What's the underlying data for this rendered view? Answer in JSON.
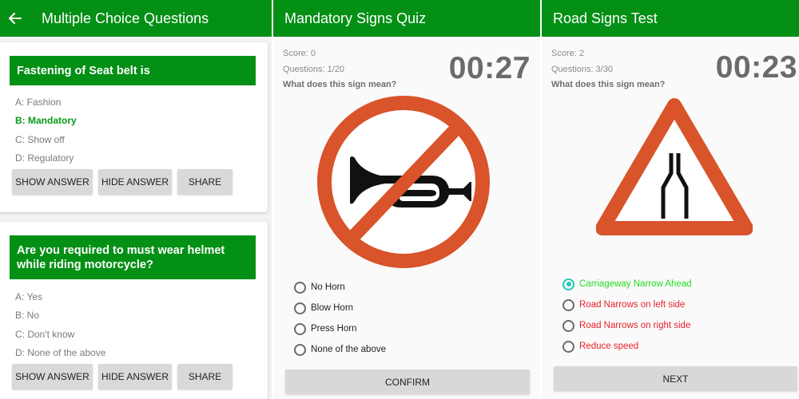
{
  "mcq": {
    "title": "Multiple Choice Questions",
    "back_icon": "arrow-left",
    "questions": [
      {
        "question": "Fastening of Seat belt is",
        "options": [
          "A: Fashion",
          "B: Mandatory",
          "C: Show off",
          "D: Regulatory"
        ],
        "highlighted_option": 1,
        "buttons": [
          "SHOW ANSWER",
          "HIDE ANSWER",
          "SHARE"
        ]
      },
      {
        "question": "Are you required to must wear helmet while riding motorcycle?",
        "options": [
          "A: Yes",
          "B: No",
          "C: Don't know",
          "D: None of the above"
        ],
        "highlighted_option": null,
        "buttons": [
          "SHOW ANSWER",
          "HIDE ANSWER",
          "SHARE"
        ]
      }
    ]
  },
  "mandatory_quiz": {
    "title": "Mandatory Signs Quiz",
    "score": "Score: 0",
    "questions": "Questions: 1/20",
    "prompt": "What does this sign mean?",
    "timer": "00:27",
    "sign": "no-horn-sign",
    "options": [
      "No Horn",
      "Blow Horn",
      "Press Horn",
      "None of the above"
    ],
    "selected": null,
    "button": "CONFIRM"
  },
  "road_test": {
    "title": "Road Signs Test",
    "score": "Score: 2",
    "questions": "Questions: 3/30",
    "prompt": "What does this sign mean?",
    "timer": "00:23",
    "sign": "carriageway-narrows-sign",
    "options": [
      "Carriageway Narrow Ahead",
      "Road Narrows on left side",
      "Road Narrows on right side",
      "Reduce speed"
    ],
    "selected": 0,
    "correct_color": "#22dd22",
    "wrong_color": "#e8212a",
    "button": "NEXT"
  },
  "colors": {
    "brand_green": "#048f15",
    "sign_red": "#d9532b",
    "radio_accent": "#1fc8b4"
  }
}
